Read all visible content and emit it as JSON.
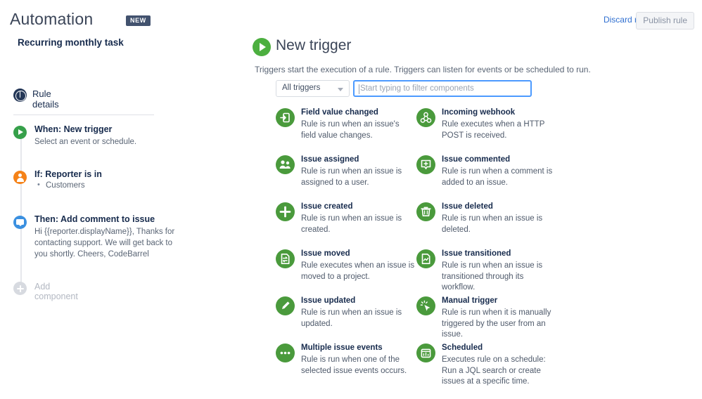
{
  "topbar": {
    "app_title": "Automation",
    "new_badge": "NEW",
    "discard_label": "Discard rule",
    "publish_label": "Publish rule"
  },
  "sidebar": {
    "rule_name": "Recurring monthly task",
    "rule_details_label": "Rule details",
    "steps": [
      {
        "icon": "play-icon",
        "color": "#36a04a",
        "title": "When: New trigger",
        "desc": "Select an event or schedule."
      },
      {
        "icon": "person-icon",
        "color": "#f58218",
        "title": "If: Reporter is in",
        "bullet": "Customers"
      },
      {
        "icon": "comment-icon",
        "color": "#3b90e0",
        "title": "Then: Add comment to issue",
        "desc": "Hi {{reporter.displayName}}, Thanks for contacting support. We will get back to you shortly. Cheers, CodeBarrel"
      }
    ],
    "add_component_label": "Add component"
  },
  "panel": {
    "title": "New trigger",
    "title_icon": "play-icon",
    "subtitle": "Triggers start the execution of a rule. Triggers can listen for events or be scheduled to run.",
    "filter": {
      "select_value": "All triggers",
      "select_icon": "chevron-down-icon",
      "search_value": "",
      "search_placeholder": "Start typing to filter components"
    },
    "accent_green": "#4a9a3c",
    "triggers": [
      {
        "icon": "field-value-changed-icon",
        "title": "Field value changed",
        "desc": "Rule is run when an issue's field value changes."
      },
      {
        "icon": "incoming-webhook-icon",
        "title": "Incoming webhook",
        "desc": "Rule executes when a HTTP POST is received."
      },
      {
        "icon": "issue-assigned-icon",
        "title": "Issue assigned",
        "desc": "Rule is run when an issue is assigned to a user."
      },
      {
        "icon": "issue-commented-icon",
        "title": "Issue commented",
        "desc": "Rule is run when a comment is added to an issue."
      },
      {
        "icon": "issue-created-icon",
        "title": "Issue created",
        "desc": "Rule is run when an issue is created."
      },
      {
        "icon": "issue-deleted-icon",
        "title": "Issue deleted",
        "desc": "Rule is run when an issue is deleted."
      },
      {
        "icon": "issue-moved-icon",
        "title": "Issue moved",
        "desc": "Rule executes when an issue is moved to a project."
      },
      {
        "icon": "issue-transitioned-icon",
        "title": "Issue transitioned",
        "desc": "Rule is run when an issue is transitioned through its workflow."
      },
      {
        "icon": "issue-updated-icon",
        "title": "Issue updated",
        "desc": "Rule is run when an issue is updated."
      },
      {
        "icon": "manual-trigger-icon",
        "title": "Manual trigger",
        "desc": "Rule is run when it is manually triggered by the user from an issue."
      },
      {
        "icon": "multiple-issue-events-icon",
        "title": "Multiple issue events",
        "desc": "Rule is run when one of the selected issue events occurs."
      },
      {
        "icon": "scheduled-icon",
        "title": "Scheduled",
        "desc": "Executes rule on a schedule: Run a JQL search or create issues at a specific time."
      }
    ]
  }
}
